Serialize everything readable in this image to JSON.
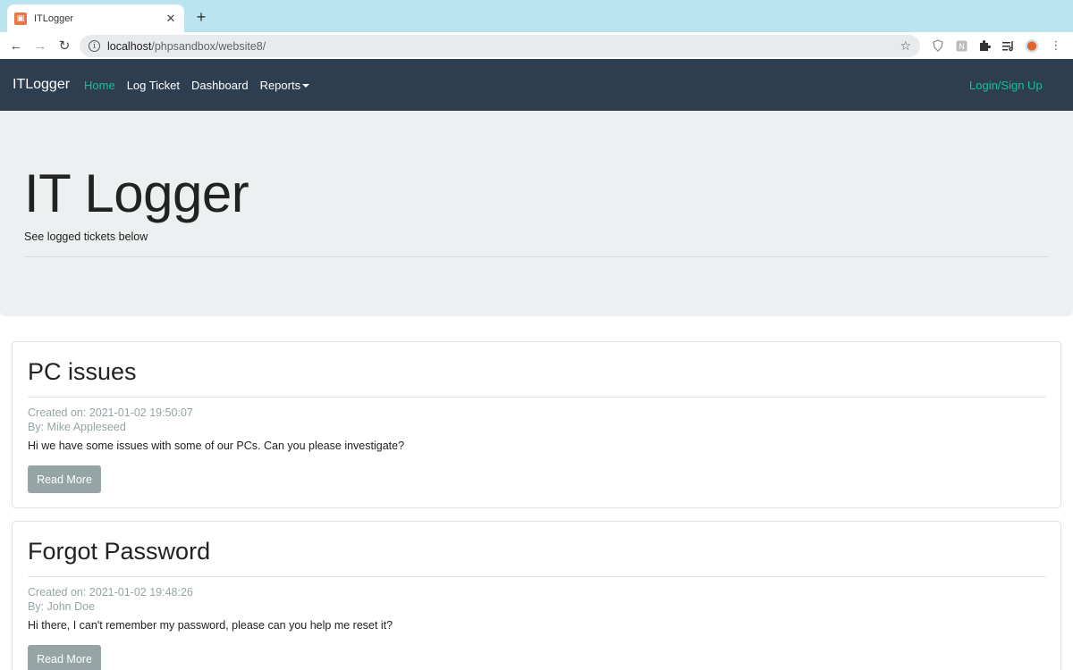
{
  "browser": {
    "tab_title": "ITLogger",
    "favicon_glyph": "☒",
    "url_host": "localhost",
    "url_path": "/phpsandbox/website8/"
  },
  "navbar": {
    "brand": "ITLogger",
    "links": [
      {
        "label": "Home",
        "active": true
      },
      {
        "label": "Log Ticket",
        "active": false
      },
      {
        "label": "Dashboard",
        "active": false
      },
      {
        "label": "Reports",
        "active": false,
        "dropdown": true
      }
    ],
    "login_label": "Login/Sign Up",
    "colors": {
      "background": "#2c3e50",
      "accent": "#1abc9c"
    }
  },
  "jumbotron": {
    "title": "IT Logger",
    "subtitle": "See logged tickets below"
  },
  "tickets": [
    {
      "title": "PC issues",
      "created": "Created on: 2021-01-02 19:50:07",
      "author": "By: Mike Appleseed",
      "body": "Hi we have some issues with some of our PCs. Can you please investigate?",
      "button_label": "Read More"
    },
    {
      "title": "Forgot Password",
      "created": "Created on: 2021-01-02 19:48:26",
      "author": "By: John Doe",
      "body": "Hi there, I can't remember my password, please can you help me reset it?",
      "button_label": "Read More"
    }
  ]
}
